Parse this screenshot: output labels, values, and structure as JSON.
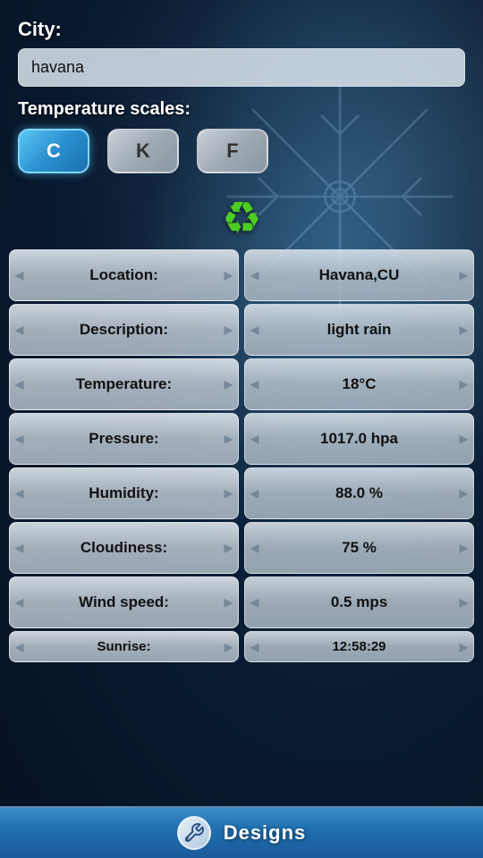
{
  "background": {
    "color_primary": "#0a1a2e",
    "color_secondary": "#1a4a6e"
  },
  "city_section": {
    "label": "City:",
    "input_value": "havana",
    "input_placeholder": "Enter city"
  },
  "temperature_scales": {
    "label": "Temperature scales:",
    "buttons": [
      {
        "id": "C",
        "label": "C",
        "active": true
      },
      {
        "id": "K",
        "label": "K",
        "active": false
      },
      {
        "id": "F",
        "label": "F",
        "active": false
      }
    ]
  },
  "refresh": {
    "icon_label": "↻",
    "aria": "Refresh weather data"
  },
  "weather_data": [
    {
      "label": "Location:",
      "value": "Havana,CU"
    },
    {
      "label": "Description:",
      "value": "light rain"
    },
    {
      "label": "Temperature:",
      "value": "18°C"
    },
    {
      "label": "Pressure:",
      "value": "1017.0 hpa"
    },
    {
      "label": "Humidity:",
      "value": "88.0 %"
    },
    {
      "label": "Cloudiness:",
      "value": "75 %"
    },
    {
      "label": "Wind speed:",
      "value": "0.5 mps"
    },
    {
      "label": "Sunrise:",
      "value": "12:58:29"
    }
  ],
  "bottom_bar": {
    "label": "Designs",
    "icon": "wrench-icon"
  }
}
